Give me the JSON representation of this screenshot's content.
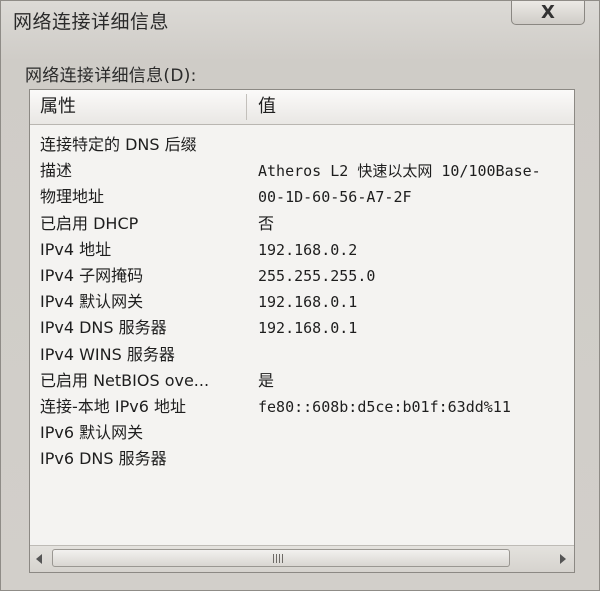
{
  "window": {
    "title": "网络连接详细信息"
  },
  "icons": {
    "close": "close-icon"
  },
  "close_glyph": "X",
  "group_label": "网络连接详细信息(D):",
  "list": {
    "columns": [
      "属性",
      "值"
    ],
    "rows": [
      {
        "property": "连接特定的 DNS 后缀",
        "value": ""
      },
      {
        "property": "描述",
        "value": "Atheros L2 快速以太网 10/100Base-"
      },
      {
        "property": "物理地址",
        "value": "00-1D-60-56-A7-2F"
      },
      {
        "property": "已启用 DHCP",
        "value": "否"
      },
      {
        "property": "IPv4 地址",
        "value": "192.168.0.2"
      },
      {
        "property": "IPv4 子网掩码",
        "value": "255.255.255.0"
      },
      {
        "property": "IPv4 默认网关",
        "value": "192.168.0.1"
      },
      {
        "property": "IPv4 DNS 服务器",
        "value": "192.168.0.1"
      },
      {
        "property": "IPv4 WINS 服务器",
        "value": ""
      },
      {
        "property": "已启用 NetBIOS ove...",
        "value": "是"
      },
      {
        "property": "连接-本地 IPv6 地址",
        "value": "fe80::608b:d5ce:b01f:63dd%11"
      },
      {
        "property": "IPv6 默认网关",
        "value": ""
      },
      {
        "property": "IPv6 DNS 服务器",
        "value": ""
      }
    ]
  }
}
